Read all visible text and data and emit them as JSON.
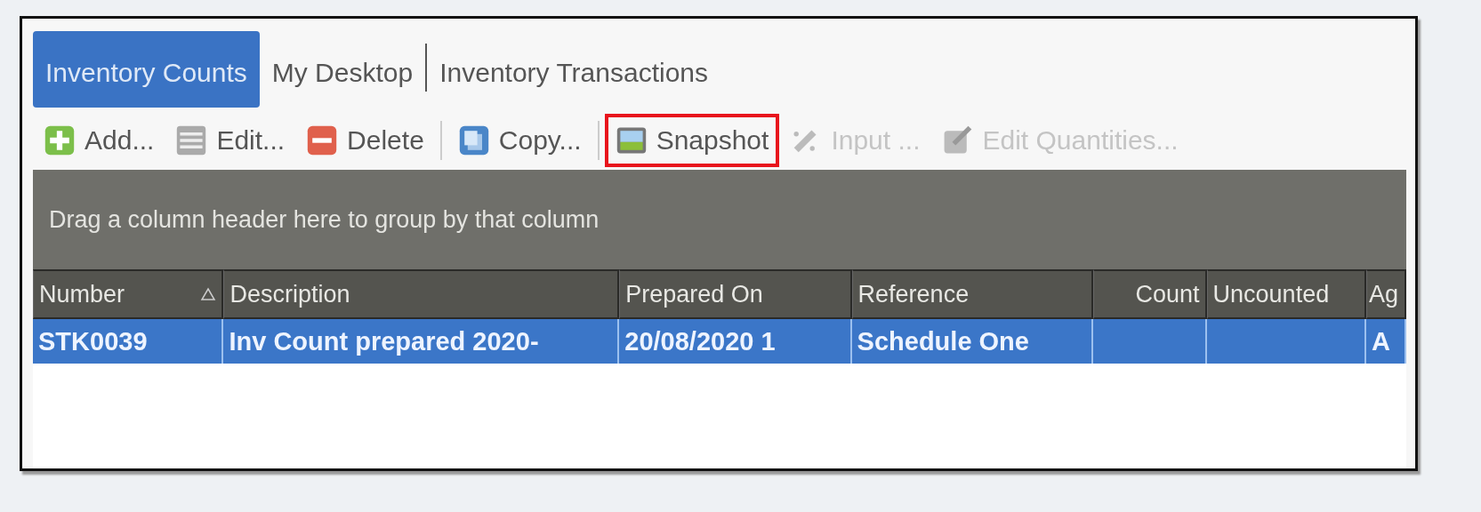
{
  "tabs": [
    {
      "label": "Inventory Counts",
      "selected": true
    },
    {
      "label": "My Desktop",
      "selected": false
    },
    {
      "label": "Inventory Transactions",
      "selected": false
    }
  ],
  "toolbar": [
    {
      "label": "Add...",
      "kind": "add",
      "disabled": false,
      "highlighted": false
    },
    {
      "label": "Edit...",
      "kind": "edit",
      "disabled": false,
      "highlighted": false
    },
    {
      "label": "Delete",
      "kind": "delete",
      "disabled": false,
      "highlighted": false
    },
    {
      "label": "Copy...",
      "kind": "copy",
      "disabled": false,
      "highlighted": false
    },
    {
      "label": "Snapshot",
      "kind": "snapshot",
      "disabled": false,
      "highlighted": true
    },
    {
      "label": "Input ...",
      "kind": "input",
      "disabled": true,
      "highlighted": false
    },
    {
      "label": "Edit Quantities...",
      "kind": "quantities",
      "disabled": true,
      "highlighted": false
    }
  ],
  "group_panel": {
    "hint": "Drag a column header here to group by that column"
  },
  "table": {
    "columns": [
      {
        "label": "Number",
        "sorted": true,
        "right_aligned": false
      },
      {
        "label": "Description",
        "sorted": false,
        "right_aligned": false
      },
      {
        "label": "Prepared On",
        "sorted": false,
        "right_aligned": false
      },
      {
        "label": "Reference",
        "sorted": false,
        "right_aligned": false
      },
      {
        "label": "Count",
        "sorted": false,
        "right_aligned": true
      },
      {
        "label": "Uncounted",
        "sorted": false,
        "right_aligned": false
      },
      {
        "label": "Ag",
        "sorted": false,
        "right_aligned": false
      }
    ],
    "rows": [
      {
        "selected": true,
        "cells": [
          "STK0039",
          "Inv Count prepared 2020-",
          "20/08/2020 1",
          "Schedule One",
          "",
          "",
          "A"
        ]
      }
    ]
  }
}
